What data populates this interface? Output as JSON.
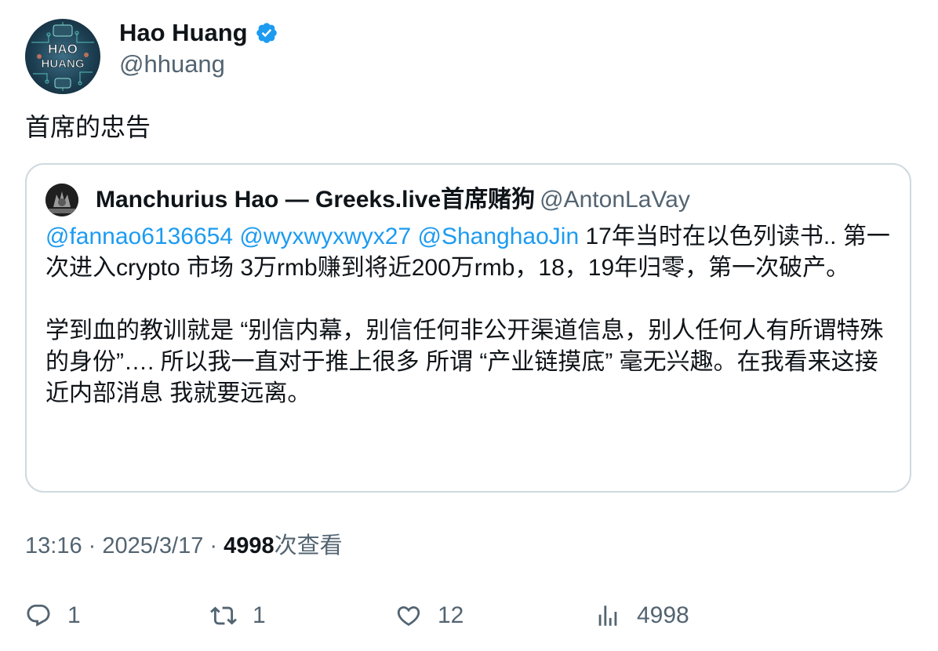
{
  "post": {
    "author": {
      "name": "Hao Huang",
      "handle": "@hhuang",
      "verified": true,
      "avatar_text_line1": "HAO",
      "avatar_text_line2": "HUANG"
    },
    "text": "首席的忠告",
    "meta": {
      "time": "13:16",
      "sep1": " · ",
      "date": "2025/3/17",
      "sep2": " · ",
      "views": "4998",
      "views_label": "次查看"
    }
  },
  "quote": {
    "name": "Manchurius Hao — Greeks.live首席赌狗",
    "handle": "@AntonLaVay",
    "mentions": [
      "@fannao6136654",
      "@wyxwyxwyx27",
      "@ShanghaoJin"
    ],
    "para1_rest": " 17年当时在以色列读书.. 第一次进入crypto 市场 3万rmb赚到将近200万rmb，18，19年归零，第一次破产。",
    "para2": "学到血的教训就是 “别信内幕，别信任何非公开渠道信息，别人任何人有所谓特殊的身份”…. 所以我一直对于推上很多 所谓 “产业链摸底” 毫无兴趣。在我看来这接近内部消息 我就要远离。"
  },
  "actions": {
    "reply": {
      "icon": "reply-icon",
      "count": "1"
    },
    "repost": {
      "icon": "repost-icon",
      "count": "1"
    },
    "like": {
      "icon": "heart-icon",
      "count": "12"
    },
    "views": {
      "icon": "views-chart-icon",
      "count": "4998"
    }
  },
  "colors": {
    "link": "#1d9bf0",
    "secondary": "#536471",
    "text": "#0f1419",
    "border": "#cfd9de",
    "verified": "#1d9bf0"
  }
}
